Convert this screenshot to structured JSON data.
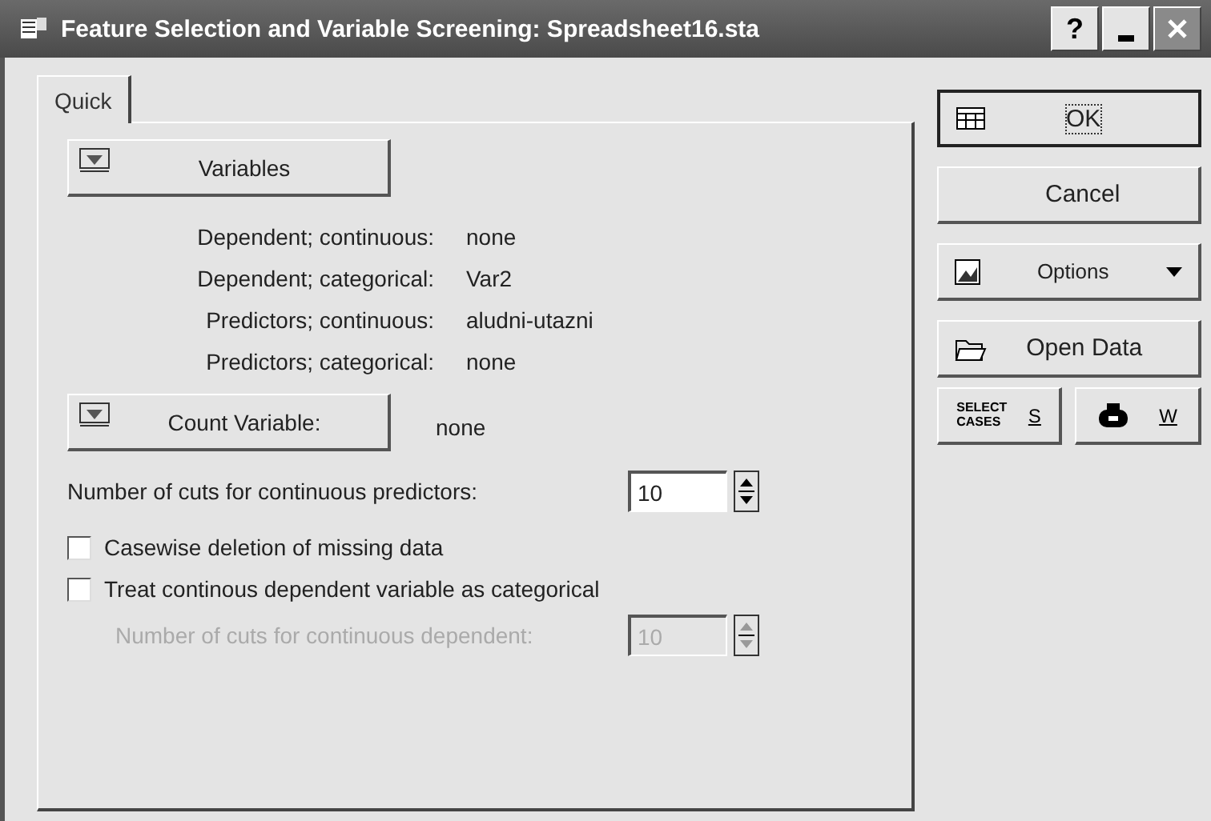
{
  "window": {
    "title": "Feature Selection and Variable Screening: Spreadsheet16.sta",
    "controls": [
      "?"
    ]
  },
  "tabs": [
    {
      "label": "Quick",
      "selected": true
    }
  ],
  "variables_button": "Variables",
  "assignments": [
    {
      "label": "Dependent; continuous:",
      "value": "none"
    },
    {
      "label": "Dependent; categorical:",
      "value": "Var2"
    },
    {
      "label": "Predictors; continuous:",
      "value": "aludni-utazni"
    },
    {
      "label": "Predictors; categorical:",
      "value": "none"
    }
  ],
  "count_variable": {
    "button": "Count Variable:",
    "value": "none"
  },
  "cuts_predictors": {
    "label": "Number of cuts for continuous predictors:",
    "value": "10",
    "disabled": false
  },
  "checkboxes": [
    {
      "label": "Casewise deletion of missing data",
      "checked": false
    },
    {
      "label": "Treat continous dependent variable as categorical",
      "checked": false
    }
  ],
  "cuts_dependent": {
    "label": "Number of cuts for continuous dependent:",
    "value": "10",
    "disabled": true
  },
  "side_buttons": [
    {
      "kind": "ok",
      "label": "OK"
    },
    {
      "kind": "cancel",
      "label": "Cancel"
    },
    {
      "kind": "options",
      "label": "Options"
    },
    {
      "kind": "open",
      "label": "Open Data"
    }
  ],
  "small_buttons": [
    {
      "kind": "select",
      "caption": "SELECT CASES",
      "label": "S"
    },
    {
      "kind": "weight",
      "label": "W"
    }
  ]
}
